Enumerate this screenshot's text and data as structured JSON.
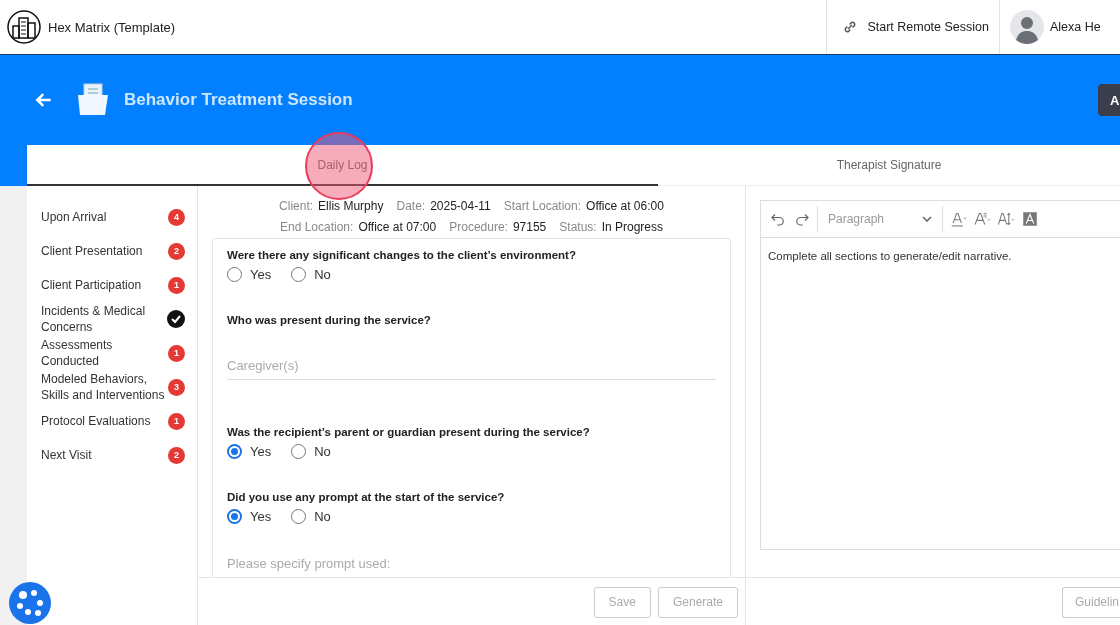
{
  "header": {
    "org_name": "Hex Matrix (Template)",
    "remote_button": "Start Remote Session",
    "user_name": "Alexa He"
  },
  "banner": {
    "title": "Behavior Treatment Session",
    "action_button": "A"
  },
  "tabs": [
    {
      "label": "Daily Log",
      "selected": true
    },
    {
      "label": "Therapist Signature",
      "selected": false
    }
  ],
  "sidebar": {
    "items": [
      {
        "label": "Upon Arrival",
        "kind": "count",
        "badge": "4",
        "color": "#e53935"
      },
      {
        "label": "Client Presentation",
        "kind": "count",
        "badge": "2",
        "color": "#e53935"
      },
      {
        "label": "Client Participation",
        "kind": "count",
        "badge": "1",
        "color": "#e53935"
      },
      {
        "label": "Incidents & Medical Concerns",
        "kind": "done",
        "color": "#111111"
      },
      {
        "label": "Assessments Conducted",
        "kind": "count",
        "badge": "1",
        "color": "#e53935"
      },
      {
        "label": "Modeled Behaviors, Skills and Interventions",
        "kind": "count",
        "badge": "3",
        "color": "#e53935"
      },
      {
        "label": "Protocol Evaluations",
        "kind": "count",
        "badge": "1",
        "color": "#e53935"
      },
      {
        "label": "Next Visit",
        "kind": "count",
        "badge": "2",
        "color": "#e53935"
      }
    ]
  },
  "session_info": [
    [
      {
        "label": "Client:",
        "value": "Ellis Murphy"
      },
      {
        "label": "Date:",
        "value": "2025-04-11"
      },
      {
        "label": "Start Location:",
        "value": "Office at 06:00"
      }
    ],
    [
      {
        "label": "End Location:",
        "value": "Office at 07:00"
      },
      {
        "label": "Procedure:",
        "value": "97155"
      },
      {
        "label": "Status:",
        "value": "In Progress"
      }
    ]
  ],
  "questions": [
    {
      "kind": "radio",
      "text": "Were there any significant changes to the client’s environment?",
      "options": [
        {
          "label": "Yes",
          "selected": false
        },
        {
          "label": "No",
          "selected": false
        }
      ]
    },
    {
      "kind": "text",
      "text": "Who was present during the service?",
      "placeholder": "Caregiver(s)"
    },
    {
      "kind": "radio",
      "text": "Was the recipient’s parent or guardian present during the service?",
      "options": [
        {
          "label": "Yes",
          "selected": true
        },
        {
          "label": "No",
          "selected": false
        }
      ]
    },
    {
      "kind": "radio",
      "text": "Did you use any prompt at the start of the service?",
      "options": [
        {
          "label": "Yes",
          "selected": true
        },
        {
          "label": "No",
          "selected": false
        }
      ]
    },
    {
      "kind": "hint",
      "text": "Please specify prompt used:"
    }
  ],
  "form_buttons": [
    {
      "label": "Save",
      "disabled": true
    },
    {
      "label": "Generate",
      "disabled": true
    }
  ],
  "editor": {
    "block_style": "Paragraph",
    "content": "Complete all sections to generate/edit narrative."
  },
  "right_button": "Guidelin"
}
